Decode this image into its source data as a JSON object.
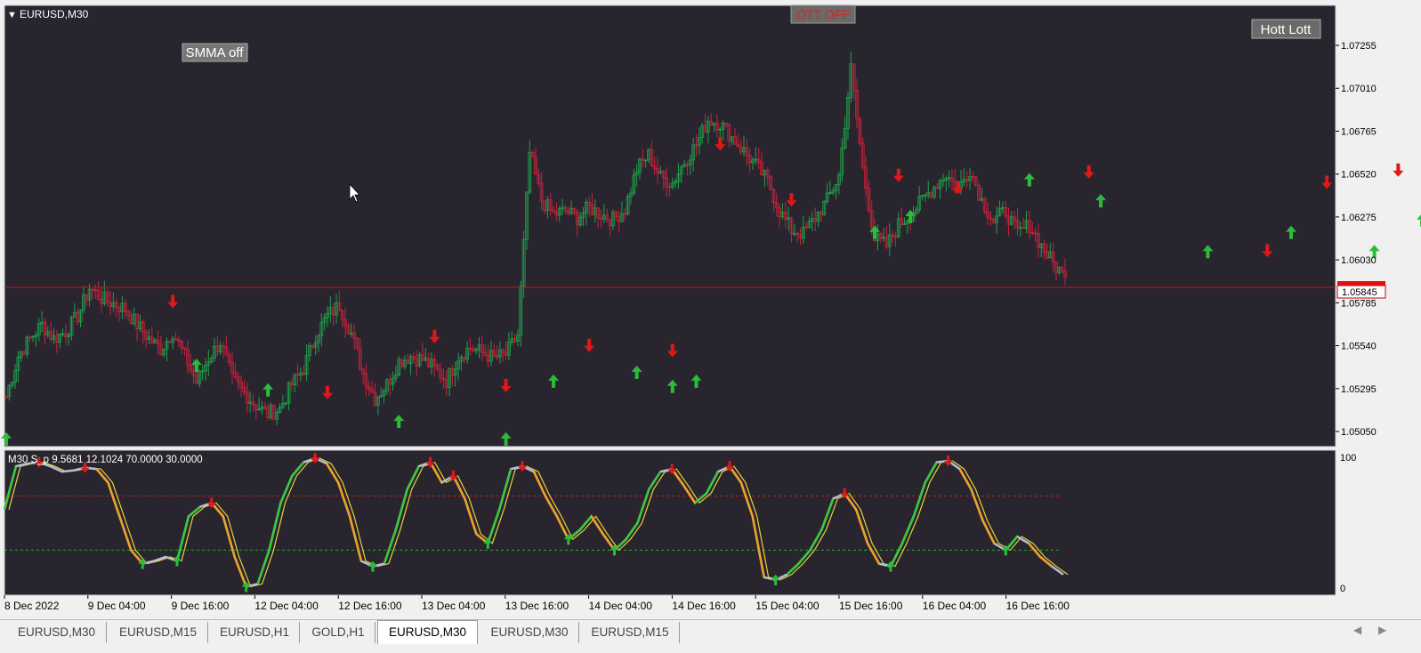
{
  "window": {
    "symbol_label": "EURUSD,M30"
  },
  "main_chart": {
    "background": "#28252f",
    "up_color": "#1fa14a",
    "down_color": "#c7223a",
    "current_price": "1.05845",
    "price_axis": [
      "1.07255",
      "1.07010",
      "1.06765",
      "1.06520",
      "1.06275",
      "1.06030",
      "1.05785",
      "1.05540",
      "1.05295",
      "1.05050"
    ],
    "buttons": {
      "smma": "SMMA off",
      "ott": "OTT OFF",
      "hott": "Hott Lott"
    },
    "price_series": [
      1.0525,
      1.0548,
      1.0558,
      1.0566,
      1.0558,
      1.0562,
      1.0571,
      1.0587,
      1.0581,
      1.0578,
      1.0575,
      1.0566,
      1.0558,
      1.0552,
      1.0562,
      1.0548,
      1.0533,
      1.0547,
      1.0556,
      1.0535,
      1.0527,
      1.052,
      1.0515,
      1.0518,
      1.0532,
      1.0541,
      1.056,
      1.0571,
      1.0577,
      1.0561,
      1.0538,
      1.0524,
      1.0532,
      1.0545,
      1.0548,
      1.0546,
      1.0541,
      1.0534,
      1.0548,
      1.0553,
      1.055,
      1.0547,
      1.0549,
      1.056,
      1.0664,
      1.0637,
      1.0629,
      1.0631,
      1.0627,
      1.0633,
      1.0629,
      1.0626,
      1.0632,
      1.0655,
      1.0663,
      1.065,
      1.0647,
      1.0659,
      1.0669,
      1.0683,
      1.0681,
      1.0673,
      1.0665,
      1.0657,
      1.0648,
      1.0631,
      1.062,
      1.0618,
      1.0627,
      1.0637,
      1.0651,
      1.0712,
      1.0655,
      1.0615,
      1.0611,
      1.0623,
      1.0629,
      1.0637,
      1.0645,
      1.0652,
      1.0643,
      1.0655,
      1.0637,
      1.0625,
      1.0631,
      1.0618,
      1.0623,
      1.0611,
      1.0601,
      1.0593
    ],
    "buy_arrows": [
      [
        0,
        1.05
      ],
      [
        16,
        1.0542
      ],
      [
        22,
        1.0528
      ],
      [
        33,
        1.051
      ],
      [
        42,
        1.05
      ],
      [
        46,
        1.0533
      ],
      [
        53,
        1.0538
      ],
      [
        56,
        1.053
      ],
      [
        58,
        1.0533
      ],
      [
        73,
        1.0618
      ],
      [
        76,
        1.0627
      ],
      [
        86,
        1.0648
      ],
      [
        92,
        1.0636
      ],
      [
        101,
        1.0607
      ],
      [
        108,
        1.0618
      ],
      [
        115,
        1.0607
      ],
      [
        119,
        1.0625
      ]
    ],
    "sell_arrows": [
      [
        14,
        1.058
      ],
      [
        27,
        1.0528
      ],
      [
        36,
        1.056
      ],
      [
        42,
        1.0532
      ],
      [
        49,
        1.0555
      ],
      [
        56,
        1.0552
      ],
      [
        60,
        1.067
      ],
      [
        66,
        1.0638
      ],
      [
        75,
        1.0652
      ],
      [
        80,
        1.0645
      ],
      [
        91,
        1.0654
      ],
      [
        106,
        1.0609
      ],
      [
        111,
        1.0648
      ],
      [
        117,
        1.0655
      ],
      [
        125,
        1.0626
      ]
    ]
  },
  "oscillator": {
    "label": "M30 S_p 9.5681 12.1024 70.0000 30.0000",
    "axis": [
      "100",
      "0"
    ],
    "upper_level": 70,
    "lower_level": 30,
    "values": [
      60,
      92,
      94,
      95,
      92,
      88,
      89,
      91,
      90,
      80,
      55,
      30,
      20,
      22,
      25,
      22,
      55,
      62,
      65,
      55,
      25,
      3,
      5,
      30,
      65,
      85,
      95,
      98,
      94,
      80,
      55,
      22,
      18,
      20,
      45,
      75,
      92,
      95,
      80,
      85,
      68,
      42,
      35,
      60,
      90,
      92,
      88,
      70,
      55,
      38,
      45,
      55,
      42,
      30,
      38,
      50,
      75,
      88,
      90,
      78,
      65,
      72,
      88,
      92,
      80,
      55,
      10,
      8,
      12,
      20,
      30,
      45,
      68,
      72,
      60,
      35,
      20,
      18,
      35,
      55,
      80,
      95,
      96,
      90,
      75,
      52,
      35,
      30,
      40,
      35,
      25,
      18,
      12
    ]
  },
  "time_axis": [
    "8 Dec 2022",
    "9 Dec 04:00",
    "9 Dec 16:00",
    "12 Dec 04:00",
    "12 Dec 16:00",
    "13 Dec 04:00",
    "13 Dec 16:00",
    "14 Dec 04:00",
    "14 Dec 16:00",
    "15 Dec 04:00",
    "15 Dec 16:00",
    "16 Dec 04:00",
    "16 Dec 16:00"
  ],
  "tabs": [
    {
      "label": "EURUSD,M30",
      "active": false
    },
    {
      "label": "EURUSD,M15",
      "active": false
    },
    {
      "label": "EURUSD,H1",
      "active": false
    },
    {
      "label": "GOLD,H1",
      "active": false
    },
    {
      "label": "EURUSD,M30",
      "active": true
    },
    {
      "label": "EURUSD,M30",
      "active": false
    },
    {
      "label": "EURUSD,M15",
      "active": false
    }
  ]
}
